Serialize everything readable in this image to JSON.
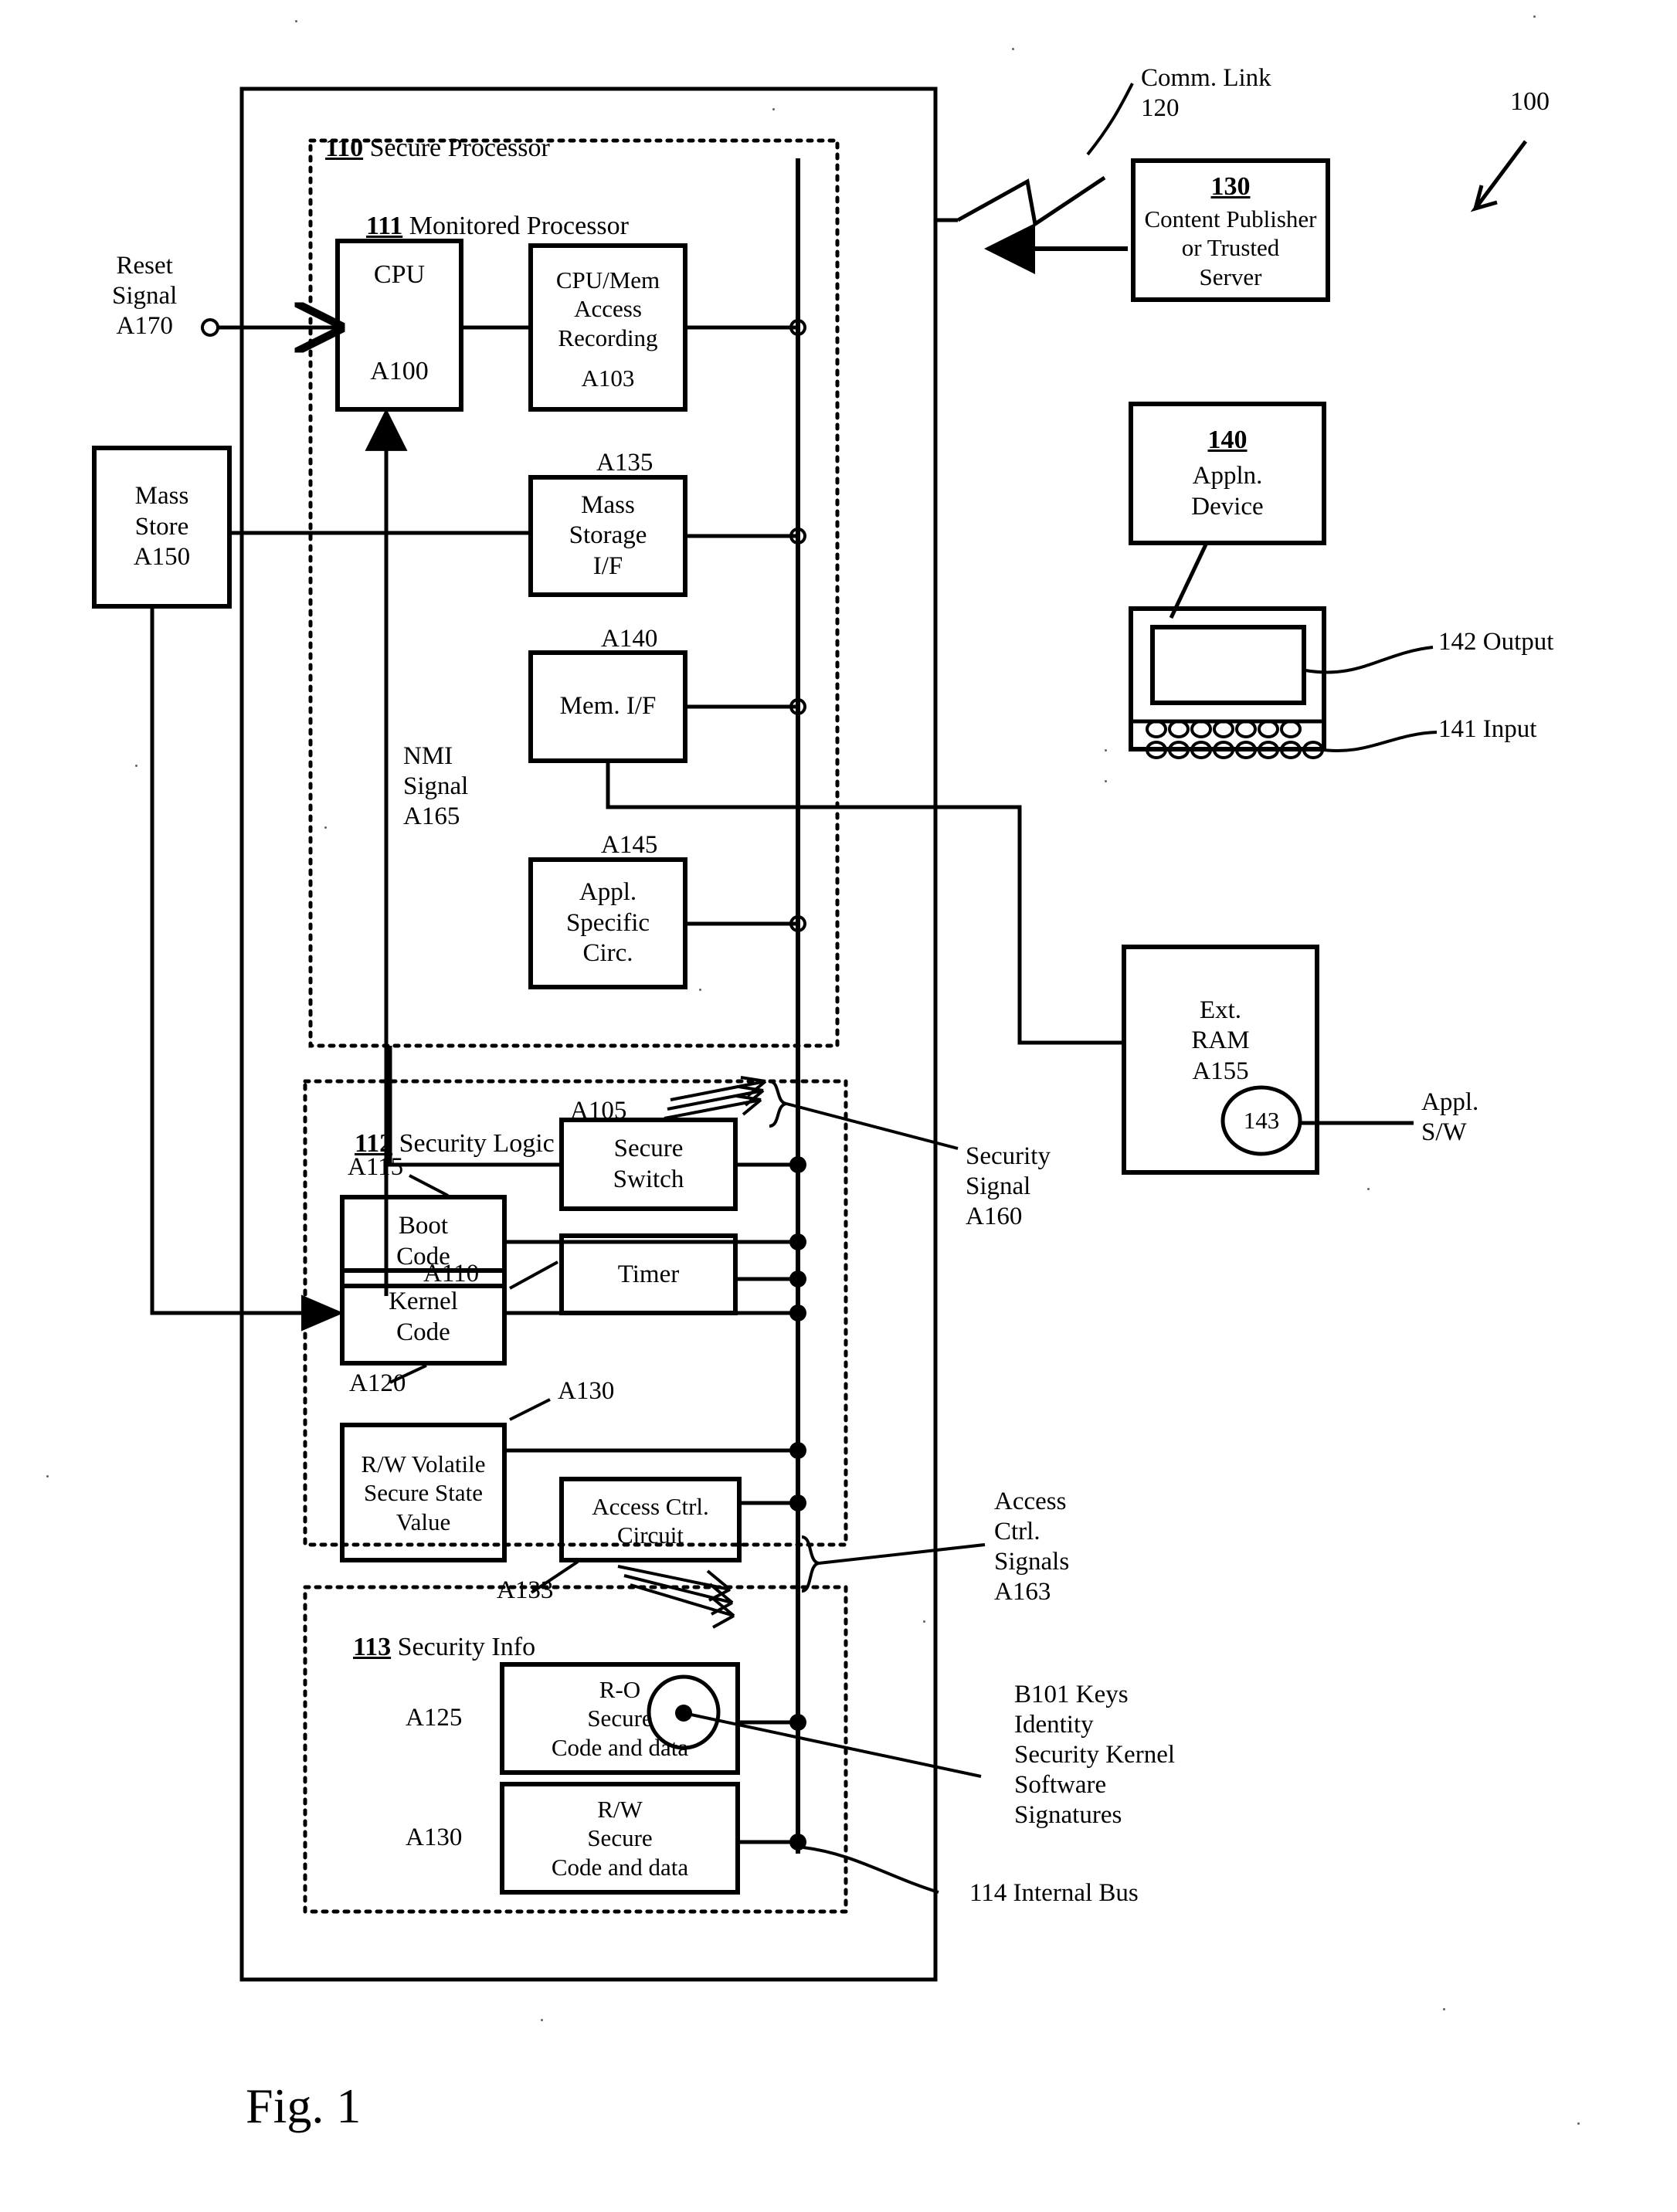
{
  "figure": {
    "caption": "Fig. 1",
    "system_ref": "100"
  },
  "containers": {
    "secure_processor": {
      "ref": "110",
      "label": "Secure Processor"
    },
    "monitored_processor": {
      "ref": "111",
      "label": "Monitored Processor"
    },
    "security_logic": {
      "ref": "112",
      "label": "Security Logic"
    },
    "security_info": {
      "ref": "113",
      "label": "Security Info"
    }
  },
  "blocks": {
    "cpu": {
      "name": "CPU",
      "ref": "A100"
    },
    "cpu_mem_access_recording": {
      "name": "CPU/Mem\nAccess\nRecording",
      "ref": "A103"
    },
    "mass_storage_if": {
      "name": "Mass\nStorage\nI/F",
      "ref": "A135"
    },
    "mem_if": {
      "name": "Mem. I/F",
      "ref": "A140"
    },
    "appl_specific_circ": {
      "name": "Appl.\nSpecific\nCirc.",
      "ref": "A145"
    },
    "secure_switch": {
      "name": "Secure\nSwitch",
      "ref": "A105"
    },
    "boot_code": {
      "name": "Boot\nCode",
      "ref": "A115"
    },
    "timer": {
      "name": "Timer",
      "ref": "A110"
    },
    "kernel_code": {
      "name": "Kernel\nCode",
      "ref": "A120"
    },
    "rw_volatile_secure_state_value": {
      "name": "R/W Volatile\nSecure State\nValue",
      "ref": "A130"
    },
    "access_ctrl_circuit": {
      "name": "Access Ctrl.\nCircuit",
      "ref": "A133"
    },
    "ro_secure_code_and_data": {
      "name": "R-O\nSecure\nCode and data",
      "ref": "A125"
    },
    "rw_secure_code_and_data": {
      "name": "R/W\nSecure\nCode and data",
      "ref": "A130"
    },
    "mass_store": {
      "name": "Mass\nStore\nA150",
      "ref": "A150"
    },
    "content_publisher": {
      "ref": "130",
      "name": "Content Publisher\nor Trusted\nServer"
    },
    "appln_device": {
      "ref": "140",
      "name": "Appln.\nDevice"
    },
    "ext_ram": {
      "name": "Ext.\nRAM\nA155",
      "ref": "A155",
      "bubble_ref": "143"
    }
  },
  "signals": {
    "reset": "Reset\nSignal\nA170",
    "nmi": "NMI\nSignal\nA165",
    "security": "Security\nSignal\nA160",
    "access_ctrl": "Access\nCtrl.\nSignals\nA163",
    "internal_bus": "114 Internal Bus",
    "comm_link": "Comm. Link\n120"
  },
  "callouts": {
    "output": "142 Output",
    "input": "141 Input",
    "appl_sw": "Appl.\nS/W",
    "b101": "B101 Keys\nIdentity\nSecurity Kernel\nSoftware\nSignatures"
  },
  "refs": {
    "a105": "A105",
    "a110": "A110",
    "a115": "A115",
    "a120": "A120",
    "a125": "A125",
    "a130_state": "A130",
    "a130_rw": "A130",
    "a133": "A133",
    "a135": "A135",
    "a140": "A140",
    "a145": "A145",
    "a150": "A150",
    "a155": "A155",
    "a160": "A160",
    "a163": "A163",
    "a165": "A165",
    "a170": "A170",
    "a100": "A100",
    "a103": "A103",
    "one_hundred": "100",
    "one_twenty": "120",
    "one_thirty": "130",
    "one_forty": "140",
    "one_forty_three": "143"
  },
  "colors": {
    "ink": "#000000",
    "paper": "#ffffff"
  }
}
